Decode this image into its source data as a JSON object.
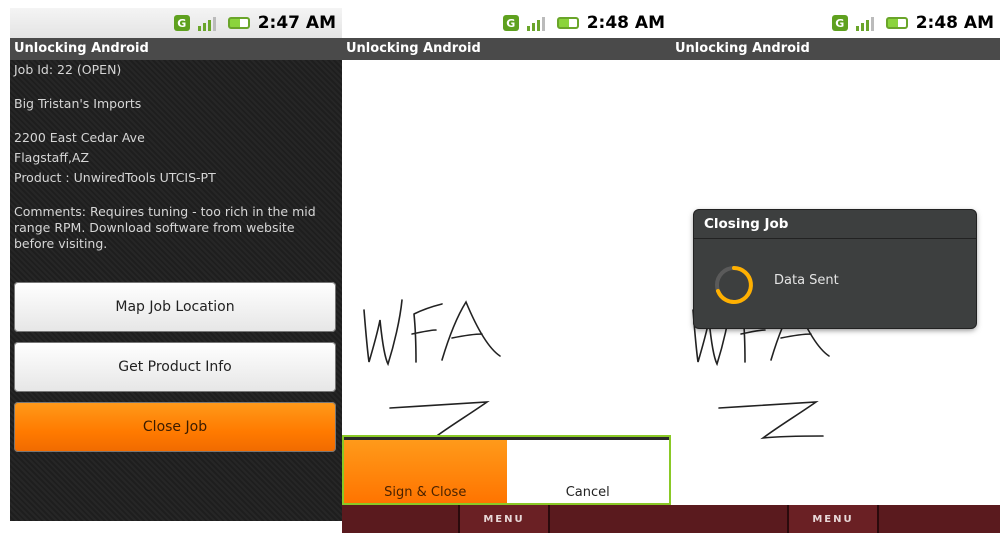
{
  "status": {
    "screen1_time": "2:47 AM",
    "screen2_time": "2:48 AM",
    "screen3_time": "2:48 AM",
    "network_badge": "G",
    "icons": [
      "network-type-icon",
      "signal-icon",
      "battery-icon"
    ],
    "battery_color": "#8bd43c"
  },
  "app": {
    "title": "Unlocking Android"
  },
  "job": {
    "id_line": "Job Id: 22 (OPEN)",
    "customer": "Big Tristan's Imports",
    "address_line1": "2200 East Cedar Ave",
    "address_line2": "Flagstaff,AZ",
    "product": "Product : UnwiredTools UTCIS-PT",
    "comments": "Comments: Requires tuning - too rich in the mid\nrange RPM.  Download software from website\nbefore visiting."
  },
  "buttons": {
    "map_job_location": "Map Job Location",
    "get_product_info": "Get Product Info",
    "close_job": "Close Job"
  },
  "signature": {
    "sign_close": "Sign & Close",
    "cancel": "Cancel"
  },
  "menu": {
    "label": "MENU"
  },
  "dialog": {
    "title": "Closing Job",
    "message": "Data Sent"
  },
  "colors": {
    "accent_orange": "#ff7a00",
    "title_bar": "#4a4a4a",
    "menu_bar": "#5a1a1e",
    "highlight_green": "#8ac926"
  }
}
